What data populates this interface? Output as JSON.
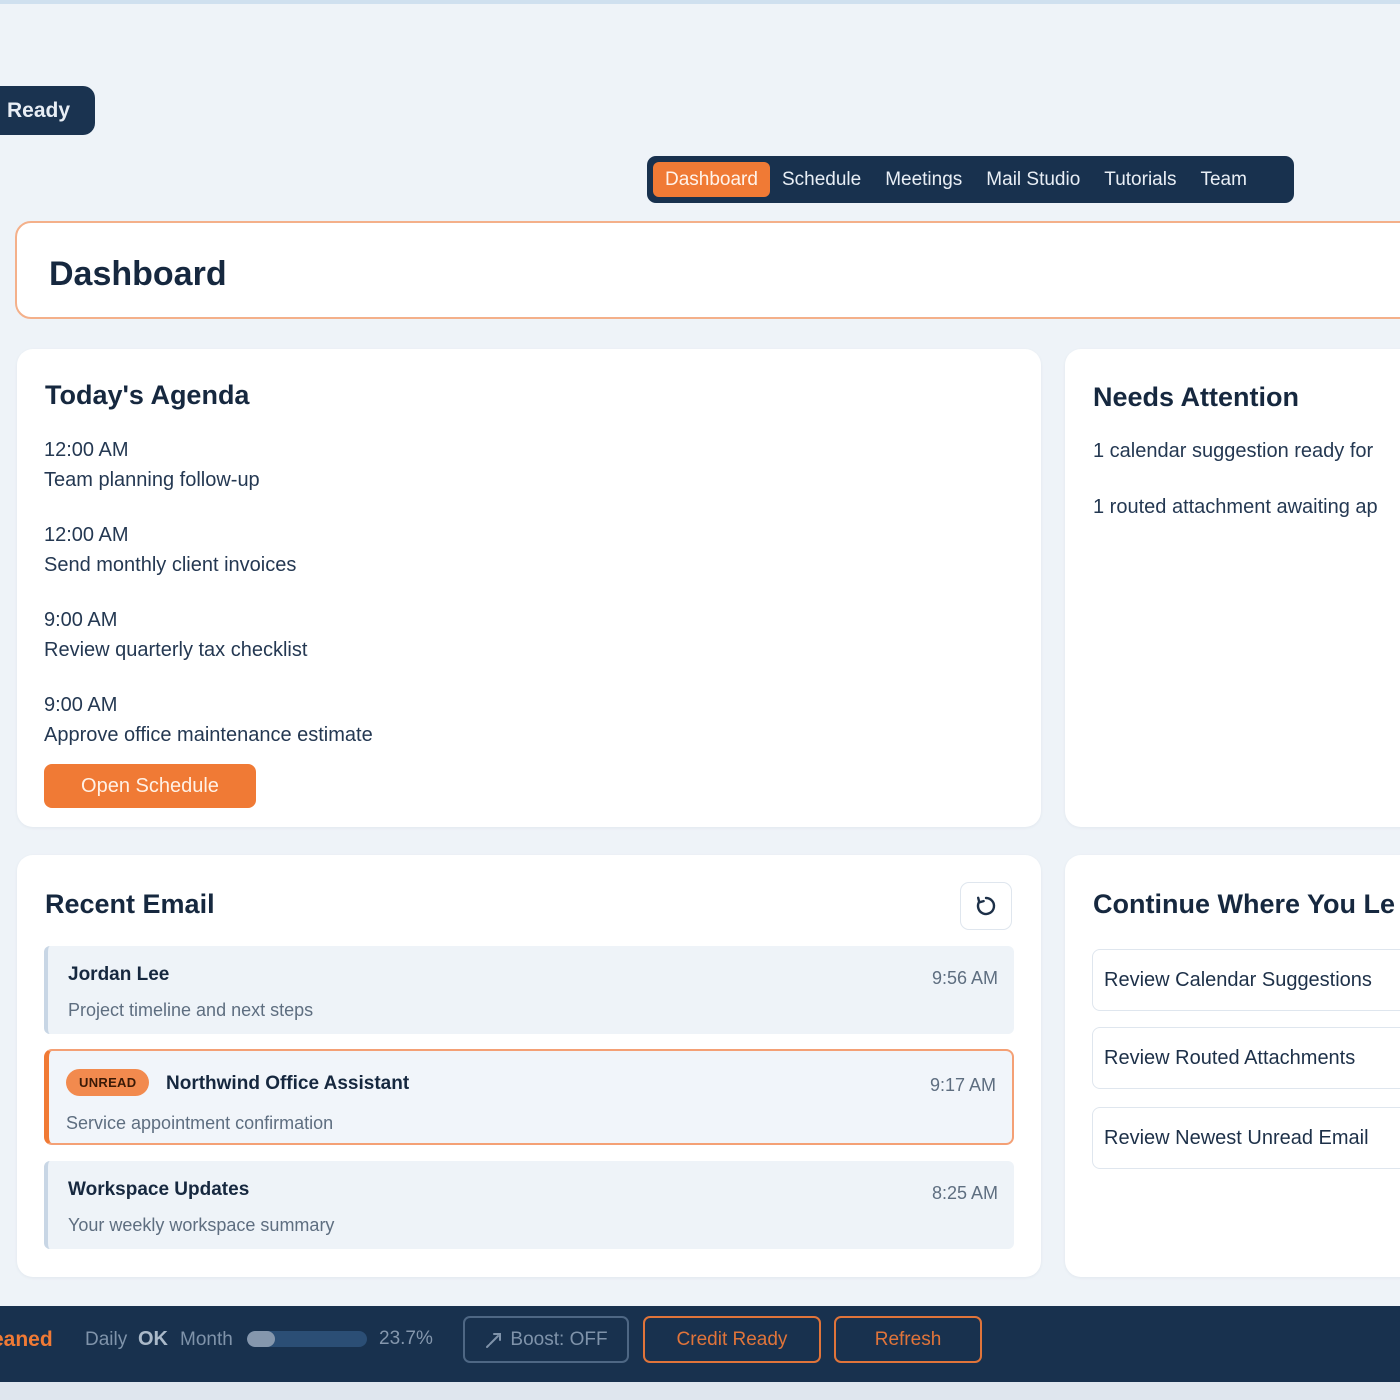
{
  "status_pill": "Ready",
  "nav": {
    "tabs": [
      {
        "label": "Dashboard",
        "active": true
      },
      {
        "label": "Schedule",
        "active": false
      },
      {
        "label": "Meetings",
        "active": false
      },
      {
        "label": "Mail Studio",
        "active": false
      },
      {
        "label": "Tutorials",
        "active": false
      },
      {
        "label": "Team",
        "active": false
      }
    ]
  },
  "page_title": "Dashboard",
  "agenda": {
    "title": "Today's Agenda",
    "items": [
      {
        "time": "12:00 AM",
        "text": "Team planning follow-up"
      },
      {
        "time": "12:00 AM",
        "text": "Send monthly client invoices"
      },
      {
        "time": "9:00 AM",
        "text": "Review quarterly tax checklist"
      },
      {
        "time": "9:00 AM",
        "text": "Approve office maintenance estimate"
      }
    ],
    "button_label": "Open Schedule"
  },
  "attention": {
    "title": "Needs Attention",
    "items": [
      "1 calendar suggestion ready for",
      "1 routed attachment awaiting ap"
    ]
  },
  "recent_email": {
    "title": "Recent Email",
    "refresh_icon": "refresh-icon",
    "emails": [
      {
        "sender": "Jordan Lee",
        "subject": "Project timeline and next steps",
        "time": "9:56 AM",
        "unread": false
      },
      {
        "sender": "Northwind Office Assistant",
        "subject": "Service appointment confirmation",
        "time": "9:17 AM",
        "unread": true,
        "badge": "UNREAD"
      },
      {
        "sender": "Workspace Updates",
        "subject": "Your weekly workspace summary",
        "time": "8:25 AM",
        "unread": false
      }
    ]
  },
  "continue": {
    "title": "Continue Where You Le",
    "items": [
      "Review Calendar Suggestions",
      "Review Routed Attachments",
      "Review Newest Unread Email"
    ]
  },
  "footer": {
    "status": "eaned",
    "daily_label": "Daily",
    "daily_value": "OK",
    "month_label": "Month",
    "month_progress_percent": 23.7,
    "month_percent_text": "23.7%",
    "boost_icon": "rocket-icon",
    "boost_label": "Boost: OFF",
    "credit_label": "Credit Ready",
    "refresh_label": "Refresh"
  },
  "colors": {
    "accent": "#f07a35",
    "navy": "#18314e",
    "background": "#eef3f8"
  }
}
